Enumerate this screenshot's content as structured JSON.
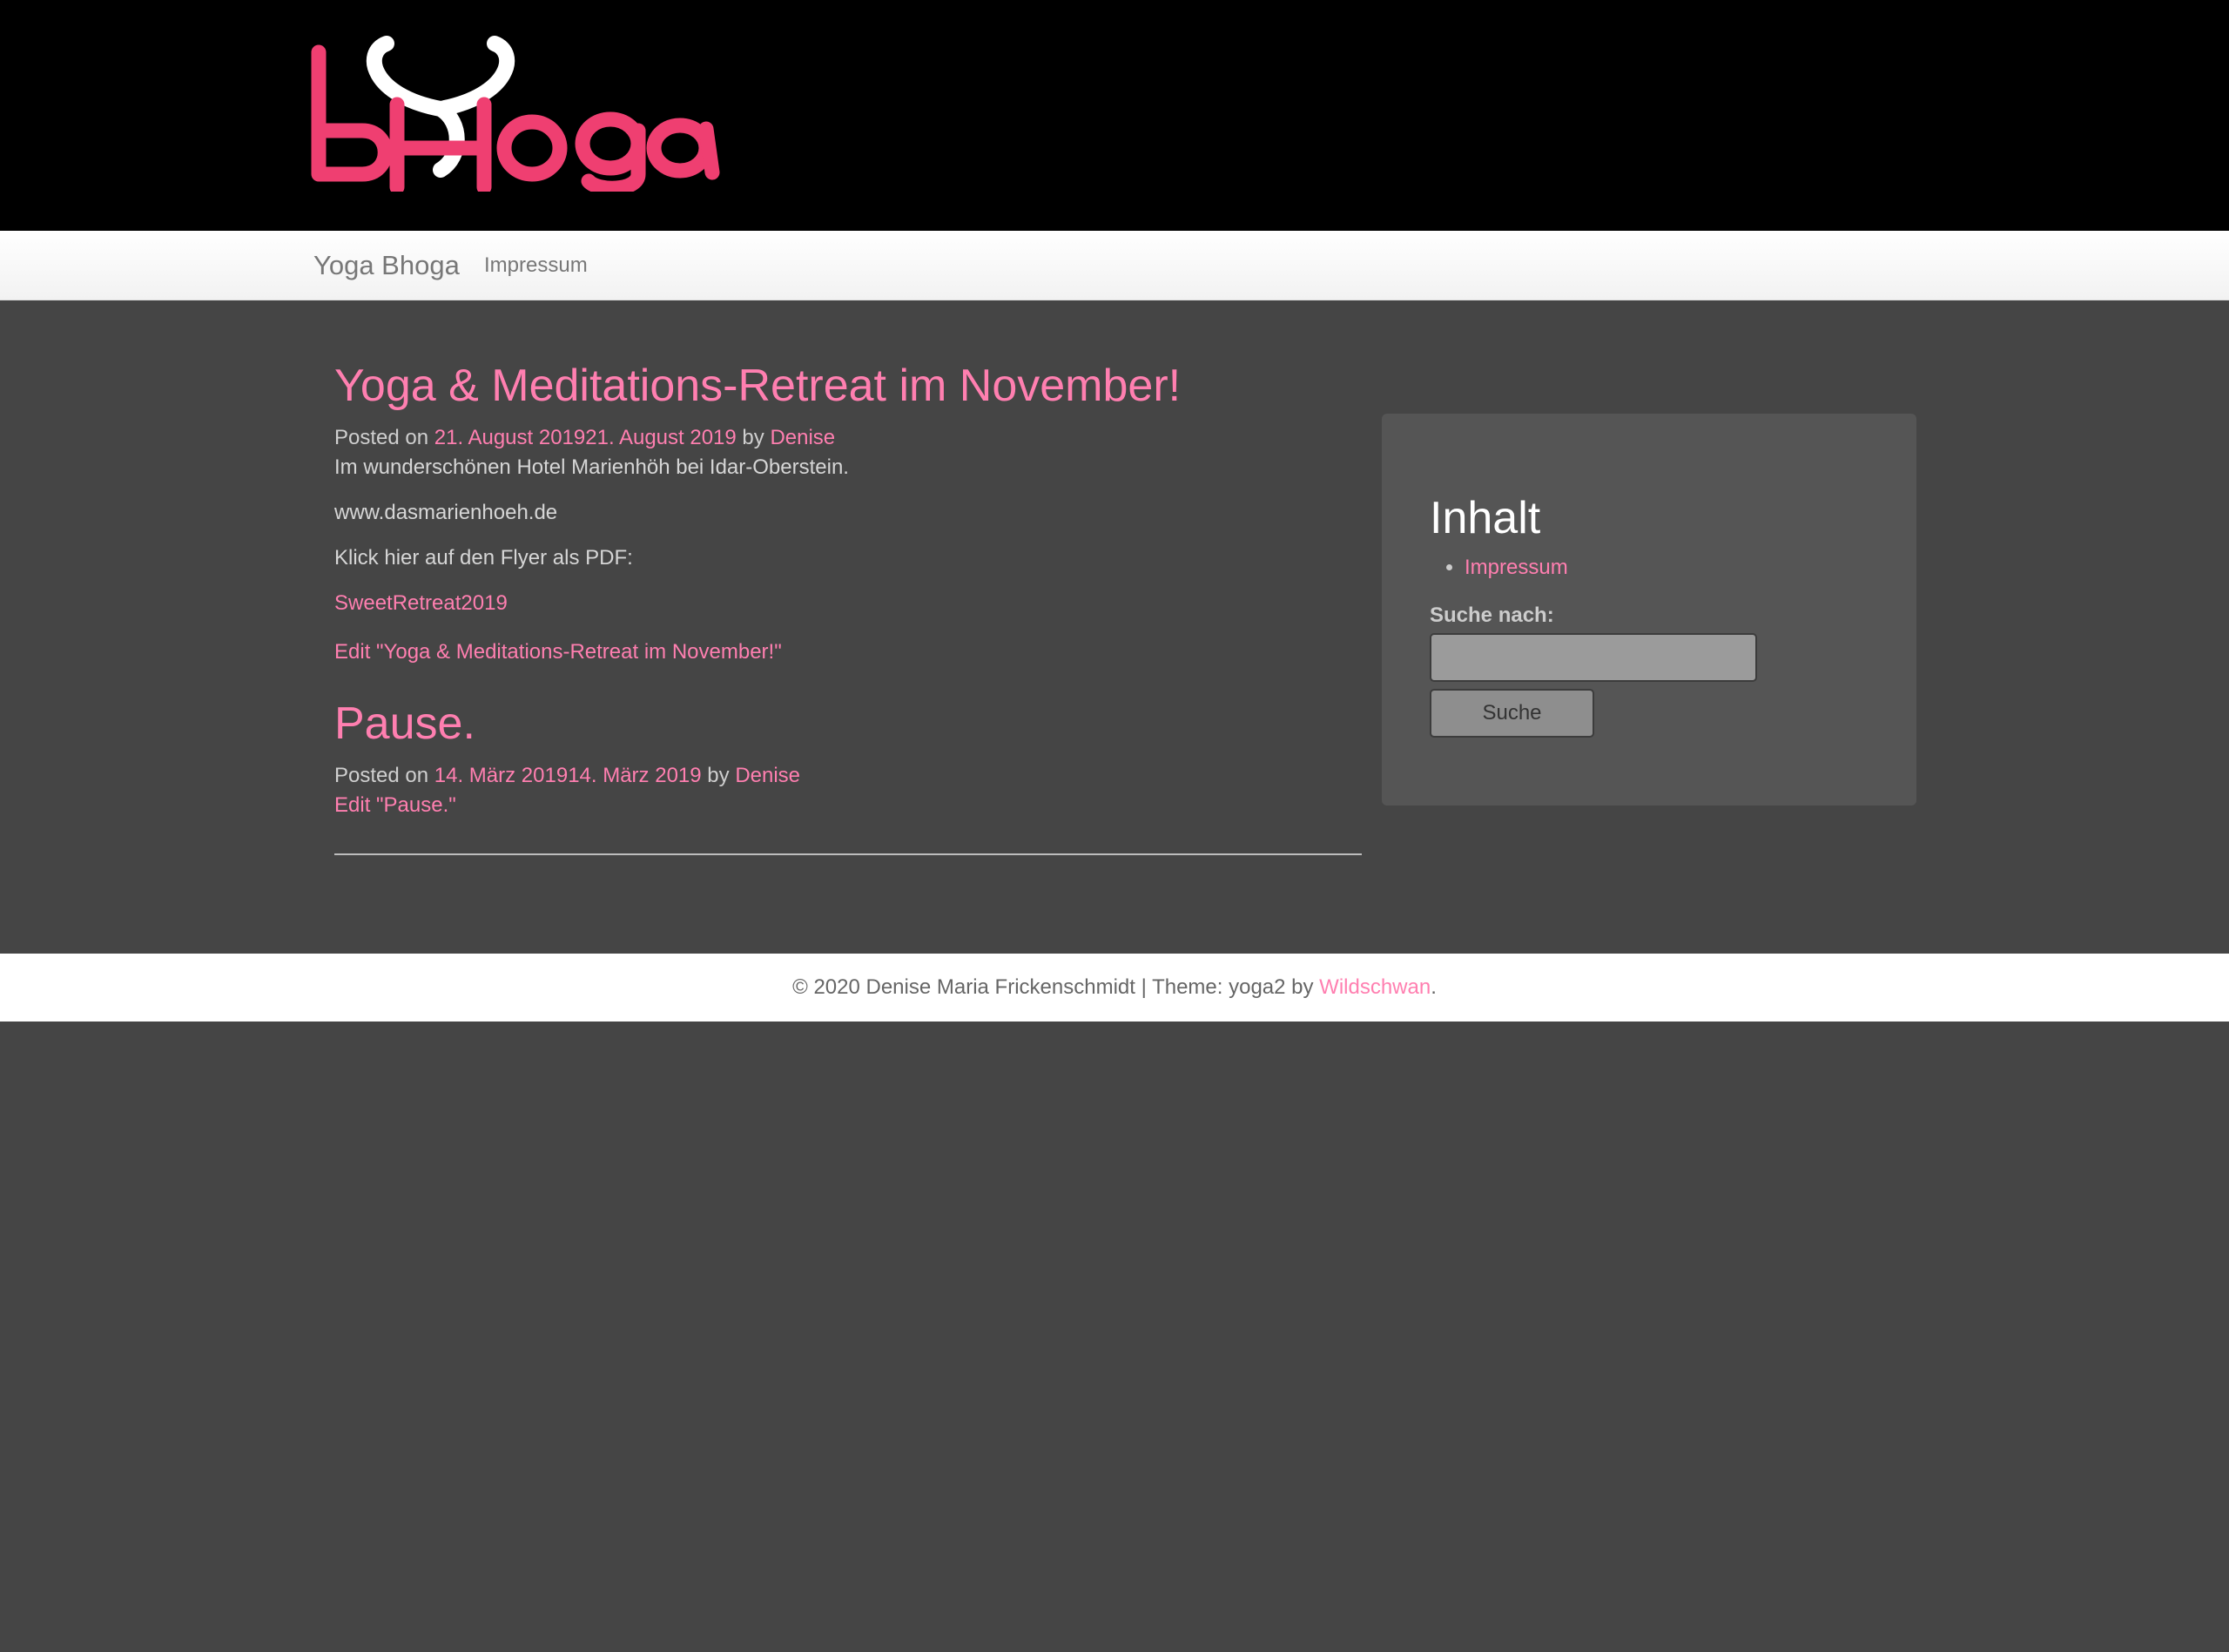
{
  "header": {
    "logo_alt": "bHoga",
    "colors": {
      "pink": "#ef3f71",
      "white": "#ffffff",
      "black": "#000000"
    }
  },
  "navbar": {
    "brand": "Yoga Bhoga",
    "items": [
      {
        "label": "Impressum"
      }
    ]
  },
  "posts": [
    {
      "title": "Yoga & Meditations-Retreat im November!",
      "meta": {
        "prefix": "Posted on",
        "date": "21. August 201921. August 2019",
        "by": "by",
        "author": "Denise"
      },
      "paragraphs": [
        "Im wunderschönen Hotel Marienhöh bei Idar-Oberstein.",
        "www.dasmarienhoeh.de",
        "Klick hier auf den Flyer als PDF:"
      ],
      "file_link": "SweetRetreat2019",
      "edit_link": "Edit \"Yoga & Meditations-Retreat im November!\""
    },
    {
      "title": "Pause.",
      "meta": {
        "prefix": "Posted on",
        "date": "14. März 201914. März 2019",
        "by": "by",
        "author": "Denise"
      },
      "edit_link": "Edit \"Pause.\""
    }
  ],
  "sidebar": {
    "title": "Inhalt",
    "items": [
      {
        "label": "Impressum"
      }
    ],
    "search_label": "Suche nach:",
    "search_value": "",
    "search_button": "Suche"
  },
  "footer": {
    "text": "© 2020 Denise Maria Frickenschmidt | Theme: yoga2 by",
    "link": "Wildschwan",
    "suffix": "."
  },
  "colors": {
    "background": "#454545",
    "accent": "#ff7fb0",
    "sidebar": "#555555"
  }
}
